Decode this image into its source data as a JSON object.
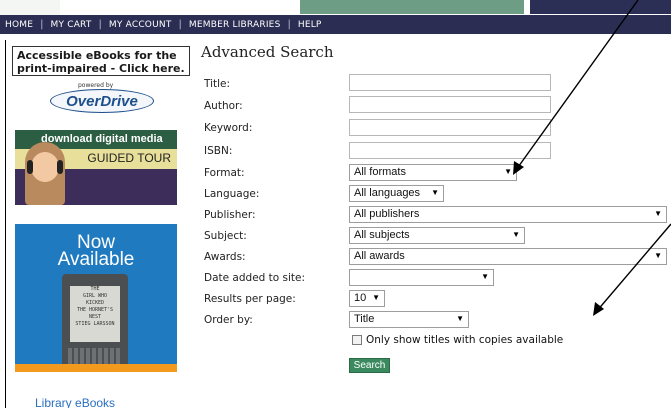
{
  "nav": {
    "items": [
      "HOME",
      "MY CART",
      "MY ACCOUNT",
      "MEMBER LIBRARIES",
      "HELP"
    ]
  },
  "sidebar": {
    "accessible_text": "Accessible eBooks for the print-impaired - Click here.",
    "overdrive_powered": "powered by",
    "overdrive_logo": "OverDrive",
    "guided_line1": "download digital media",
    "guided_line2": "GUIDED TOUR",
    "kindle_now": "Now",
    "kindle_available": "Available",
    "kindle_book_lines": [
      "THE",
      "GIRL WHO",
      "KICKED",
      "THE HORNET'S",
      "NEST",
      "STIEG LARSSON"
    ],
    "library_ebooks": "Library eBooks"
  },
  "form": {
    "title": "Advanced Search",
    "labels": {
      "title": "Title:",
      "author": "Author:",
      "keyword": "Keyword:",
      "isbn": "ISBN:",
      "format": "Format:",
      "language": "Language:",
      "publisher": "Publisher:",
      "subject": "Subject:",
      "awards": "Awards:",
      "date_added": "Date added to site:",
      "results_per_page": "Results per page:",
      "order_by": "Order by:"
    },
    "values": {
      "format": "All formats",
      "language": "All languages",
      "publisher": "All publishers",
      "subject": "All subjects",
      "awards": "All awards",
      "date_added": "",
      "results_per_page": "10",
      "order_by": "Title"
    },
    "available_only_label": "Only show titles with copies available",
    "search_button": "Search"
  },
  "colors": {
    "nav_bg": "#2b2d52",
    "search_button": "#3b8a5f",
    "kindle_ad_bg": "#1f7ac0",
    "link_blue": "#2a6fc0"
  }
}
